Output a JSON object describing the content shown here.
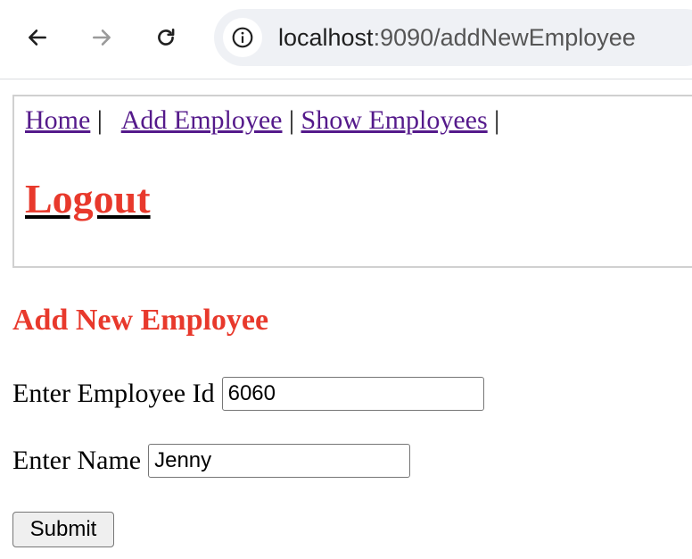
{
  "browser": {
    "url_host": "localhost",
    "url_path": ":9090/addNewEmployee"
  },
  "nav": {
    "home": "Home",
    "add_employee": "Add Employee",
    "show_employees": "Show Employees",
    "separator": "|",
    "logout": "Logout"
  },
  "form": {
    "title": "Add New Employee",
    "id_label": "Enter Employee Id",
    "id_value": "6060",
    "name_label": "Enter Name",
    "name_value": "Jenny",
    "submit_label": "Submit"
  }
}
